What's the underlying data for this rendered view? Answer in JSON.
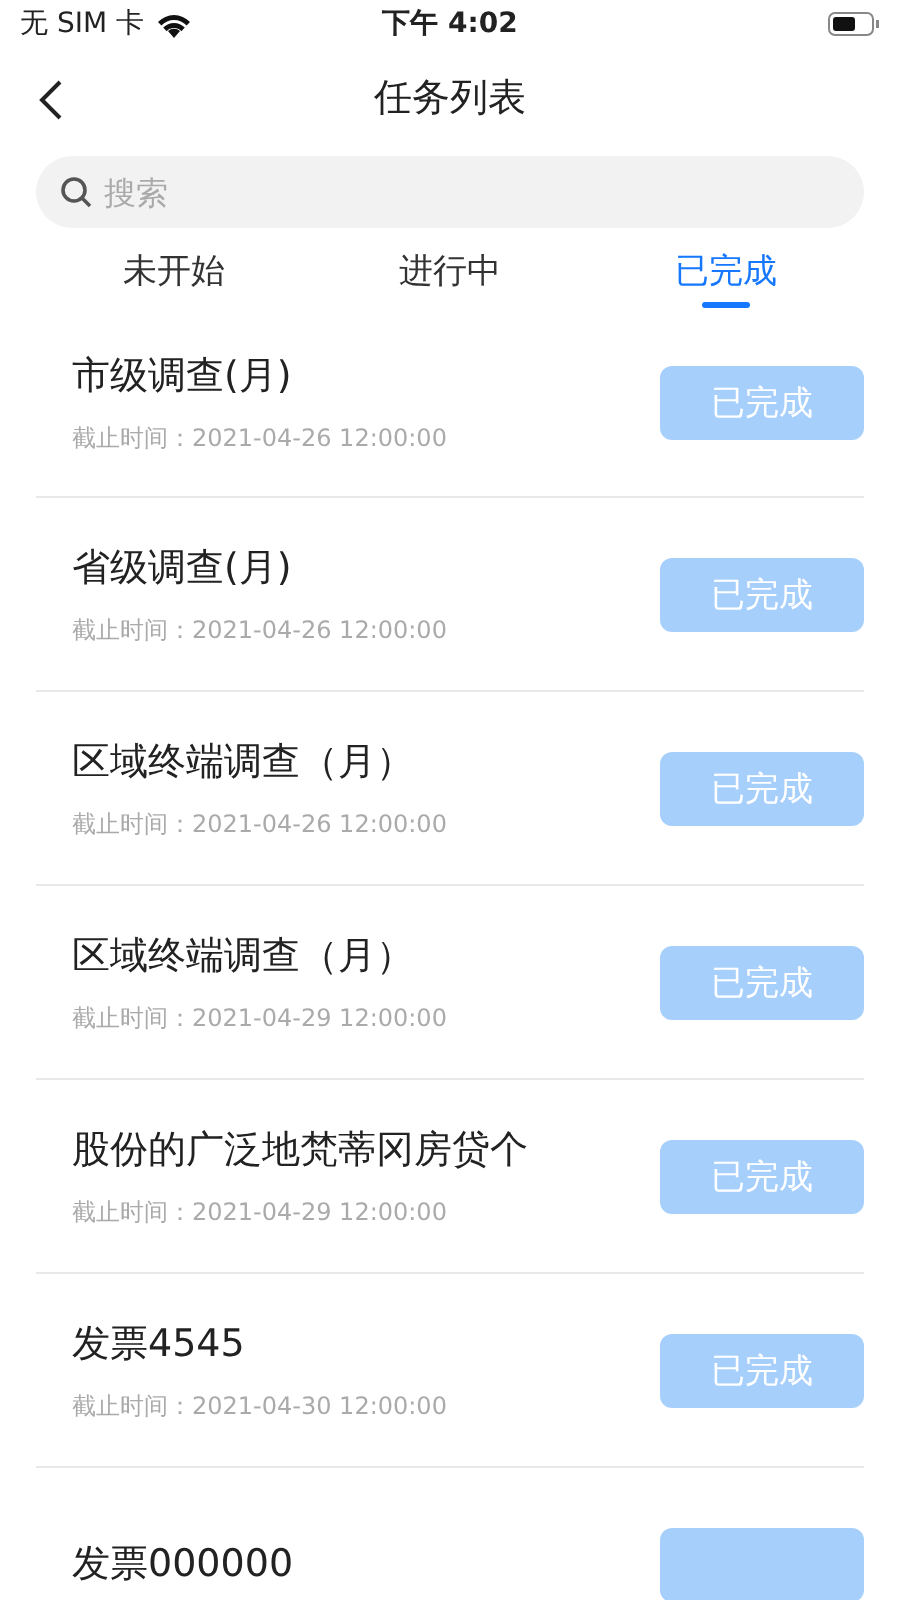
{
  "status_bar": {
    "carrier": "无 SIM 卡",
    "time": "下午 4:02"
  },
  "nav": {
    "title": "任务列表"
  },
  "search": {
    "placeholder": "搜索"
  },
  "tabs": [
    {
      "label": "未开始",
      "selected": false
    },
    {
      "label": "进行中",
      "selected": false
    },
    {
      "label": "已完成",
      "selected": true
    }
  ],
  "tasks": [
    {
      "title": "市级调查(月)",
      "deadline": "截止时间：2021-04-26 12:00:00",
      "status": "已完成"
    },
    {
      "title": "省级调查(月)",
      "deadline": "截止时间：2021-04-26 12:00:00",
      "status": "已完成"
    },
    {
      "title": "区域终端调查（月）",
      "deadline": "截止时间：2021-04-26 12:00:00",
      "status": "已完成"
    },
    {
      "title": "区域终端调查（月）",
      "deadline": "截止时间：2021-04-29 12:00:00",
      "status": "已完成"
    },
    {
      "title": "股份的广泛地梵蒂冈房贷个",
      "deadline": "截止时间：2021-04-29 12:00:00",
      "status": "已完成"
    },
    {
      "title": "发票4545",
      "deadline": "截止时间：2021-04-30 12:00:00",
      "status": "已完成"
    },
    {
      "title": "发票000000"
    }
  ]
}
